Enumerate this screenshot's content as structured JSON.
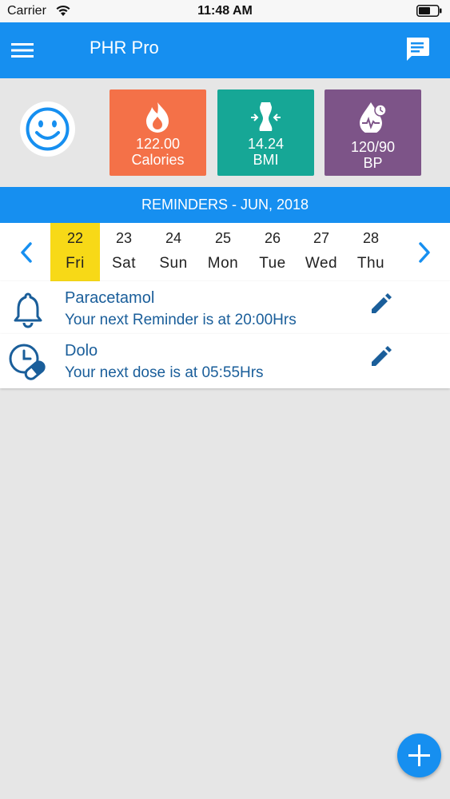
{
  "status_bar": {
    "carrier": "Carrier",
    "time": "11:48 AM"
  },
  "nav": {
    "title": "PHR Pro",
    "menu_icon": "hamburger-icon",
    "chat_icon": "chat-icon"
  },
  "stats": {
    "avatar_icon": "smiley-face-icon",
    "cards": [
      {
        "value": "122.00",
        "label": "Calories",
        "icon": "flame-icon",
        "color": "#f47148"
      },
      {
        "value": "14.24",
        "label": "BMI",
        "icon": "body-measure-icon",
        "color": "#16a796"
      },
      {
        "value": "120/90",
        "label": "BP",
        "icon": "blood-drop-icon",
        "color": "#7d5488"
      }
    ]
  },
  "reminders_header": "REMINDERS - JUN, 2018",
  "week": {
    "days": [
      {
        "num": "22",
        "name": "Fri",
        "selected": true
      },
      {
        "num": "23",
        "name": "Sat"
      },
      {
        "num": "24",
        "name": "Sun"
      },
      {
        "num": "25",
        "name": "Mon"
      },
      {
        "num": "26",
        "name": "Tue"
      },
      {
        "num": "27",
        "name": "Wed"
      },
      {
        "num": "28",
        "name": "Thu"
      }
    ]
  },
  "reminders": [
    {
      "title": "Paracetamol",
      "subtitle": "Your next Reminder is at 20:00Hrs",
      "icon": "bell-icon"
    },
    {
      "title": "Dolo",
      "subtitle": "Your next dose is at 05:55Hrs",
      "icon": "pill-clock-icon"
    }
  ],
  "colors": {
    "primary": "#168ff0",
    "selected_day": "#f7d917",
    "text_blue": "#1a5e9a",
    "background": "#e6e6e6"
  }
}
